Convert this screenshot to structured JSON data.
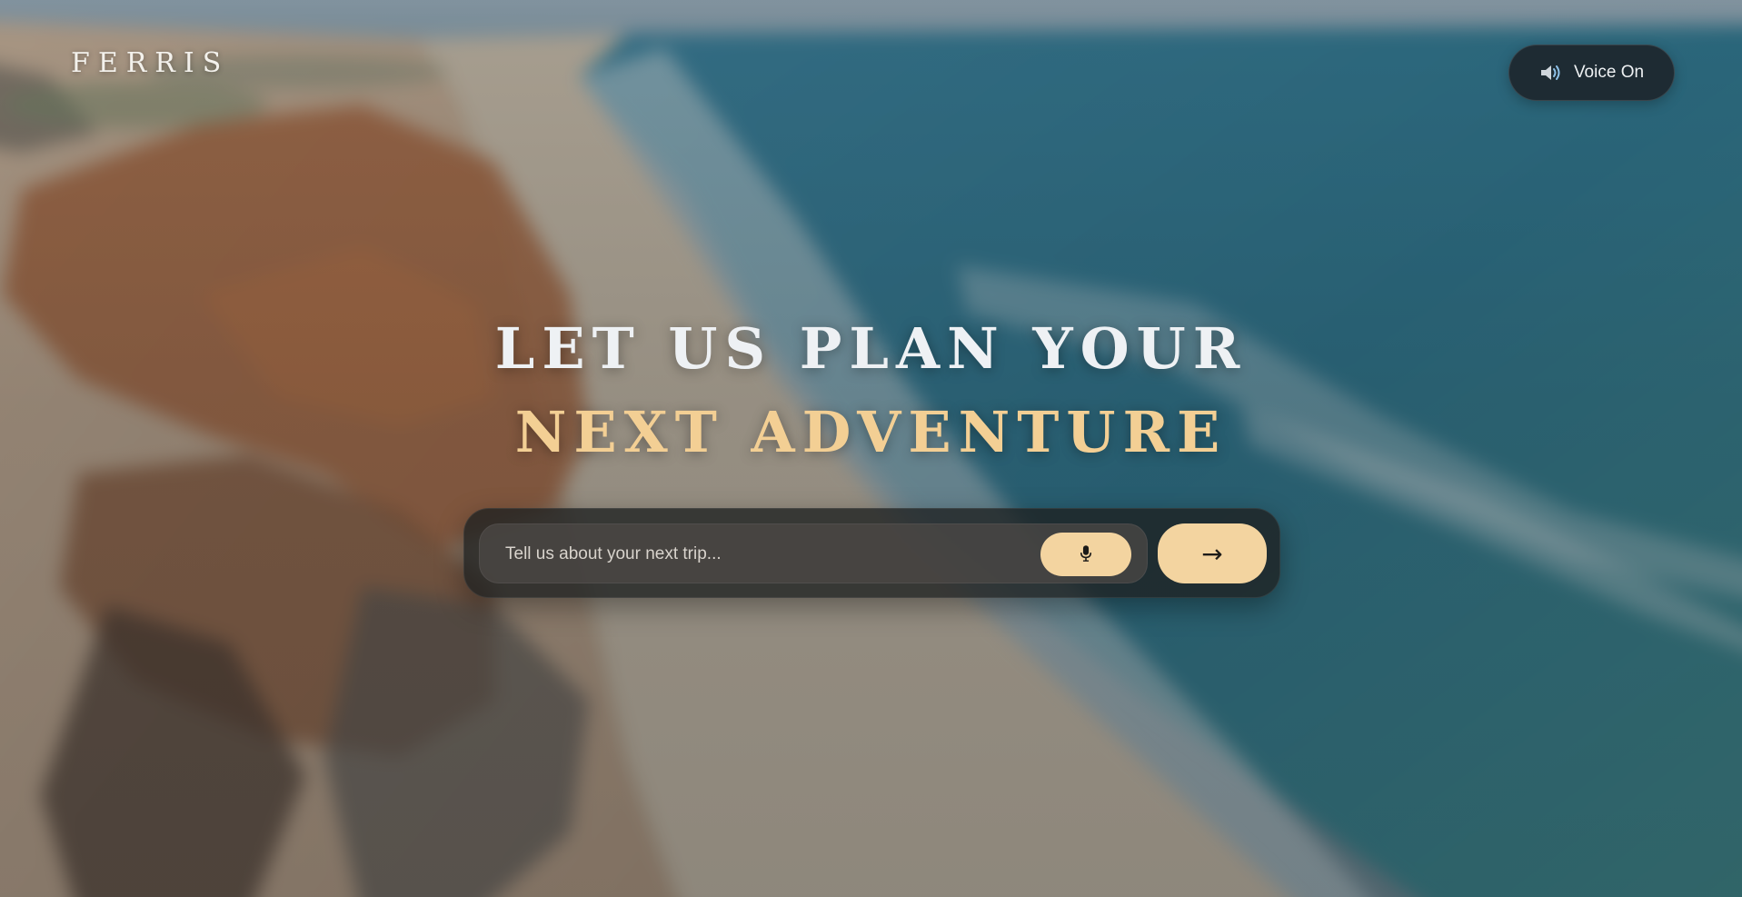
{
  "brand": {
    "name": "FERRIS"
  },
  "voice_toggle": {
    "label": "Voice On",
    "icon": "speaker-icon"
  },
  "hero": {
    "line1": "LET US PLAN YOUR",
    "line2": "NEXT ADVENTURE"
  },
  "composer": {
    "placeholder": "Tell us about your next trip...",
    "value": "",
    "mic_icon": "microphone-icon",
    "submit_label": "→"
  },
  "colors": {
    "accent": "#f3d4a0",
    "hero_highlight": "#f3cf94",
    "voice_toggle_bg": "#1c2228",
    "composer_bg": "#1e2020"
  }
}
